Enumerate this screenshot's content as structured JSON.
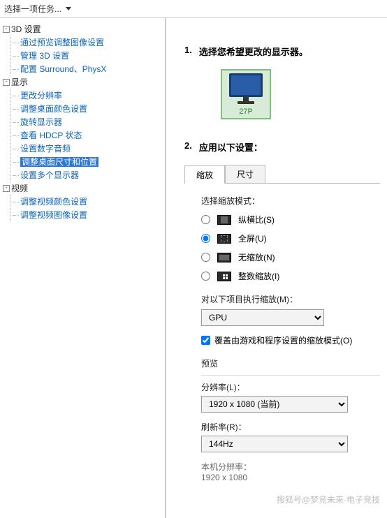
{
  "top": {
    "task_label": "选择一项任务..."
  },
  "tree": {
    "g0": {
      "label": "3D 设置",
      "children": [
        "通过预览调整图像设置",
        "管理 3D 设置",
        "配置 Surround、PhysX"
      ]
    },
    "g1": {
      "label": "显示",
      "children": [
        "更改分辨率",
        "调整桌面颜色设置",
        "旋转显示器",
        "查看 HDCP 状态",
        "设置数字音频",
        "调整桌面尺寸和位置",
        "设置多个显示器"
      ],
      "selected_index": 5
    },
    "g2": {
      "label": "视频",
      "children": [
        "调整视频颜色设置",
        "调整视频图像设置"
      ]
    }
  },
  "content": {
    "s1_num": "1.",
    "s1_title": "选择您希望更改的显示器。",
    "monitor_label": "27P",
    "s2_num": "2.",
    "s2_title": "应用以下设置：",
    "tabs": {
      "scale": "缩放",
      "size": "尺寸"
    },
    "mode_label": "选择缩放模式：",
    "modes": {
      "aspect": "纵横比(S)",
      "full": "全屏(U)",
      "none": "无缩放(N)",
      "integer": "整数缩放(I)"
    },
    "target_label": "对以下项目执行缩放(M)：",
    "target_value": "GPU",
    "override_label": "覆盖由游戏和程序设置的缩放模式(O)",
    "preview_label": "预览",
    "res_label": "分辨率(L)：",
    "res_value": "1920 x 1080 (当前)",
    "refresh_label": "刷新率(R)：",
    "refresh_value": "144Hz",
    "native_label": "本机分辨率：",
    "native_value": "1920 x 1080"
  },
  "watermark": "搜狐号@梦竞未来·电子竞技"
}
